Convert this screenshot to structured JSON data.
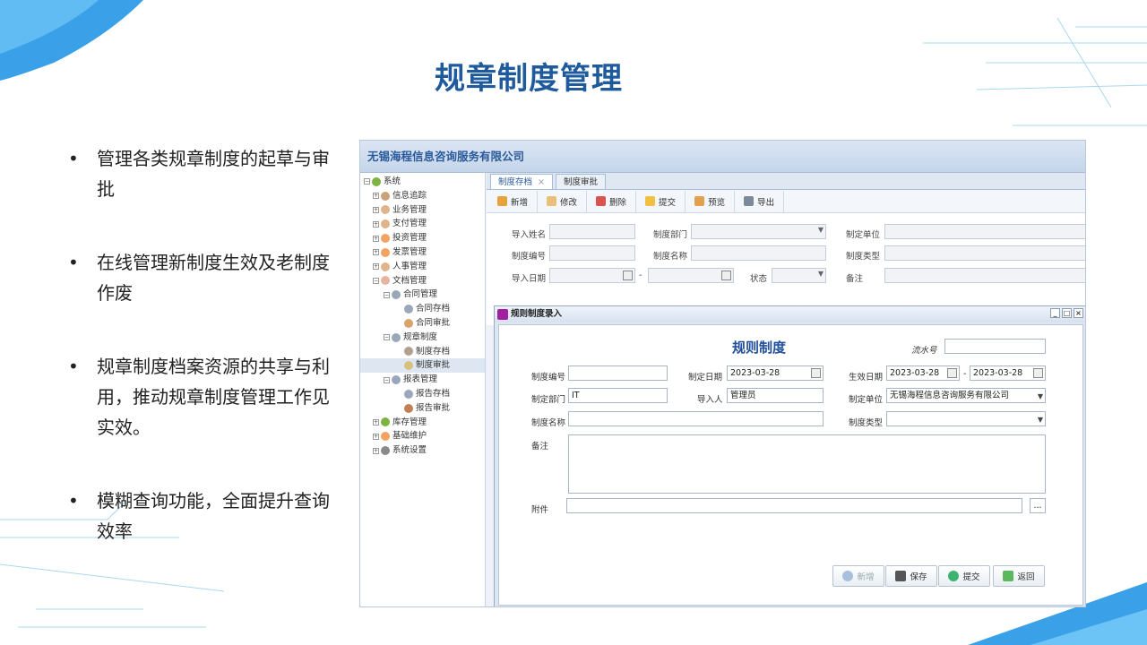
{
  "slide": {
    "title": "规章制度管理",
    "bullets": [
      "管理各类规章制度的起草与审批",
      "在线管理新制度生效及老制度作废",
      "规章制度档案资源的共享与利用，推动规章制度管理工作见实效。",
      "模糊查询功能，全面提升查询效率"
    ],
    "bullet_marker": "•"
  },
  "app": {
    "company": "无锡海程信息咨询服务有限公司",
    "tree": [
      {
        "toggle": "⊟",
        "label": "系统",
        "level": 0,
        "icon_color": "#7cb342"
      },
      {
        "toggle": "⊞",
        "label": "信息追踪",
        "level": 1,
        "icon_color": "#c9a27a"
      },
      {
        "toggle": "⊞",
        "label": "业务管理",
        "level": 1,
        "icon_color": "#e0b48a"
      },
      {
        "toggle": "⊞",
        "label": "支付管理",
        "level": 1,
        "icon_color": "#e0b48a"
      },
      {
        "toggle": "⊞",
        "label": "投资管理",
        "level": 1,
        "icon_color": "#f4a460"
      },
      {
        "toggle": "⊞",
        "label": "发票管理",
        "level": 1,
        "icon_color": "#f4a460"
      },
      {
        "toggle": "⊞",
        "label": "人事管理",
        "level": 1,
        "icon_color": "#e0b48a"
      },
      {
        "toggle": "⊟",
        "label": "文档管理",
        "level": 1,
        "icon_color": "#e8b4a0"
      },
      {
        "toggle": "⊟",
        "label": "合同管理",
        "level": 2,
        "icon_color": "#9aa7b8"
      },
      {
        "toggle": "",
        "label": "合同存档",
        "level": 3,
        "icon_color": "#9aa7b8"
      },
      {
        "toggle": "",
        "label": "合同审批",
        "level": 3,
        "icon_color": "#d9a46a"
      },
      {
        "toggle": "⊟",
        "label": "规章制度",
        "level": 2,
        "icon_color": "#9aa7b8"
      },
      {
        "toggle": "",
        "label": "制度存档",
        "level": 3,
        "icon_color": "#b0a090"
      },
      {
        "toggle": "",
        "label": "制度审批",
        "level": 3,
        "icon_color": "#d9c080",
        "selected": true
      },
      {
        "toggle": "⊟",
        "label": "报表管理",
        "level": 2,
        "icon_color": "#9aa7b8"
      },
      {
        "toggle": "",
        "label": "报告存档",
        "level": 3,
        "icon_color": "#9aa7b8"
      },
      {
        "toggle": "",
        "label": "报告审批",
        "level": 3,
        "icon_color": "#c08050"
      },
      {
        "toggle": "⊞",
        "label": "库存管理",
        "level": 1,
        "icon_color": "#7cb342"
      },
      {
        "toggle": "⊞",
        "label": "基础维护",
        "level": 1,
        "icon_color": "#f4a460"
      },
      {
        "toggle": "⊞",
        "label": "系统设置",
        "level": 1,
        "icon_color": "#8a8a8a"
      }
    ],
    "tabs": [
      {
        "label": "制度存档",
        "close": "×",
        "active": true
      },
      {
        "label": "制度审批",
        "close": "",
        "active": false
      }
    ],
    "toolbar": [
      {
        "label": "新增",
        "icon": "add-icon",
        "color": "#e6a23c"
      },
      {
        "label": "修改",
        "icon": "edit-icon",
        "color": "#e8c07a"
      },
      {
        "label": "删除",
        "icon": "delete-icon",
        "color": "#d9534f"
      },
      {
        "label": "提交",
        "icon": "submit-icon",
        "color": "#f0c040"
      },
      {
        "label": "预览",
        "icon": "preview-icon",
        "color": "#e0a050"
      },
      {
        "label": "导出",
        "icon": "export-icon",
        "color": "#7a8a9a"
      }
    ],
    "filter": {
      "import_name": "导入姓名",
      "dept": "制度部门",
      "unit": "制定单位",
      "code": "制度编号",
      "name": "制度名称",
      "type": "制度类型",
      "import_date": "导入日期",
      "dash": "-",
      "status": "状态",
      "remark": "备注"
    },
    "dialog": {
      "title": "规则制度录入",
      "form_title": "规则制度",
      "serial_label": "流水号",
      "code_label": "制度编号",
      "make_date_label": "制定日期",
      "make_date": "2023-03-28",
      "effect_date_label": "生效日期",
      "effect_from": "2023-03-28",
      "dash": "-",
      "effect_to": "2023-03-28",
      "dept_label": "制定部门",
      "dept_value": "IT",
      "importer_label": "导入人",
      "importer_value": "管理员",
      "unit_label": "制定单位",
      "unit_value": "无锡海程信息咨询服务有限公司",
      "name_label": "制度名称",
      "type_label": "制度类型",
      "remark_label": "备注",
      "attach_label": "附件",
      "browse": "...",
      "buttons": {
        "new": "新增",
        "save": "保存",
        "submit": "提交",
        "back": "返回"
      },
      "win": {
        "min": "_",
        "max": "□",
        "close": "×"
      }
    }
  }
}
